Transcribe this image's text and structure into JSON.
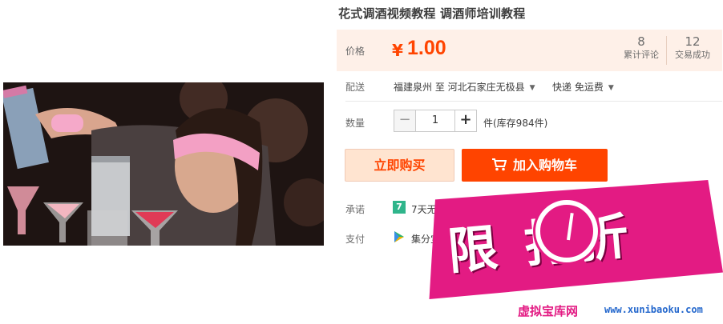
{
  "product": {
    "title": "花式调酒视频教程 调酒师培训教程"
  },
  "price": {
    "label": "价格",
    "currency": "¥",
    "amount": "1.00",
    "reviews_count": "8",
    "reviews_label": "累计评论",
    "trades_count": "12",
    "trades_label": "交易成功"
  },
  "shipping": {
    "label": "配送",
    "route": "福建泉州 至  河北石家庄无极县",
    "method": "快递 免运费"
  },
  "quantity": {
    "label": "数量",
    "value": "1",
    "minus": "−",
    "plus": "+",
    "stock": "件(库存984件)"
  },
  "actions": {
    "buy_now": "立即购买",
    "add_to_cart": "加入购物车"
  },
  "promise": {
    "label": "承诺",
    "badge": "7",
    "text": "7天无理由"
  },
  "payment": {
    "label": "支付",
    "text": "集分宝"
  },
  "watermark": {
    "stamp": "限 打折",
    "site_cn": "虚拟宝库网",
    "site_en": "www.xunibaoku.com"
  },
  "colors": {
    "accent": "#ff4400",
    "price_bg": "#fef0e8",
    "watermark": "#e31b83"
  }
}
